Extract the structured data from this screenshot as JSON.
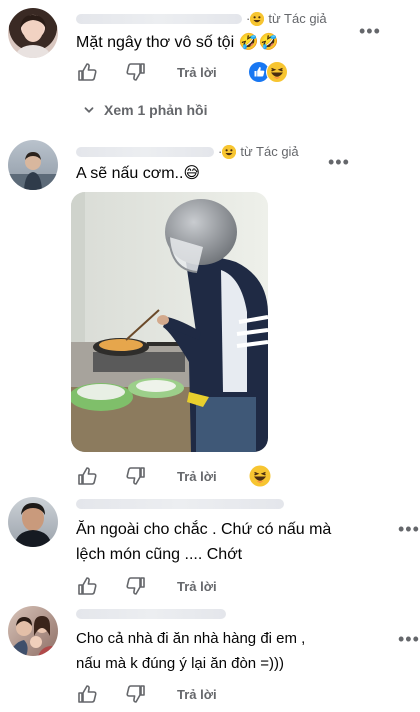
{
  "comments": [
    {
      "meta_suffix": "· ",
      "badge": "từ Tác giả",
      "text": "Mặt ngây thơ vô số tội 🤣🤣",
      "reply_label": "Trả lời",
      "view_replies": "Xem 1 phản hồi"
    },
    {
      "meta_suffix": "· ",
      "badge": "từ Tác giả",
      "text": "A sẽ nấu cơm..😅",
      "reply_label": "Trả lời"
    },
    {
      "text_line1": "Ăn ngoài cho chắc . Chứ có nấu mà",
      "text_line2": "lệch món cũng .... Chớt",
      "reply_label": "Trả lời"
    },
    {
      "text_line1": "Cho cả nhà đi ăn nhà hàng đi em ,",
      "text_line2": "nấu mà k đúng ý lại ăn đòn =)))",
      "reply_label": "Trả lời"
    }
  ],
  "colors": {
    "secondary_text": "#65676b",
    "like_blue": "#1877f2",
    "emoji_yellow": "#f7c531"
  },
  "icons": [
    "like-icon",
    "dislike-icon",
    "more-icon",
    "chevron-down-icon",
    "haha-emoji-icon",
    "grin-emoji-icon"
  ]
}
